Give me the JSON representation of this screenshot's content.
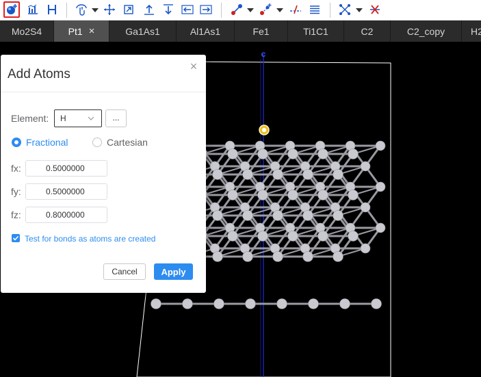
{
  "toolbar": {
    "buttons": [
      {
        "name": "add-atom-icon",
        "active": true
      },
      {
        "name": "bar-chart-icon"
      },
      {
        "name": "h-bonds-icon"
      },
      {
        "name": "rotate-hand-icon"
      },
      {
        "name": "move-icon"
      },
      {
        "name": "scale-icon"
      },
      {
        "name": "arrow-up-icon"
      },
      {
        "name": "arrow-down-icon"
      },
      {
        "name": "arrow-left-icon"
      },
      {
        "name": "arrow-right-icon"
      },
      {
        "name": "bond-icon"
      },
      {
        "name": "add-bond-icon"
      },
      {
        "name": "break-bond-icon"
      },
      {
        "name": "lines-icon"
      },
      {
        "name": "bond-length-icon"
      },
      {
        "name": "delete-bonds-icon"
      }
    ]
  },
  "tabs": [
    {
      "label": "Mo2S4",
      "active": false
    },
    {
      "label": "Pt1",
      "active": true,
      "close": "×"
    },
    {
      "label": "Ga1As1",
      "active": false
    },
    {
      "label": "Al1As1",
      "active": false
    },
    {
      "label": "Fe1",
      "active": false
    },
    {
      "label": "Ti1C1",
      "active": false
    },
    {
      "label": "C2",
      "active": false
    },
    {
      "label": "C2_copy",
      "active": false
    },
    {
      "label": "H2",
      "active": false
    }
  ],
  "viewport": {
    "axis_label": "c",
    "colors": {
      "atom": "#c9c9d0",
      "bond": "#9a9aa2",
      "axis": "#1f2fd0",
      "cell": "#ffffff",
      "selected": "#f0c020"
    }
  },
  "dialog": {
    "title": "Add Atoms",
    "close": "×",
    "element_label": "Element:",
    "element_value": "H",
    "browse_label": "...",
    "coord_modes": [
      {
        "label": "Fractional",
        "checked": true
      },
      {
        "label": "Cartesian",
        "checked": false
      }
    ],
    "fields": [
      {
        "label": "fx:",
        "value": "0.5000000"
      },
      {
        "label": "fy:",
        "value": "0.5000000"
      },
      {
        "label": "fz:",
        "value": "0.8000000"
      }
    ],
    "test_bonds_label": "Test for bonds as atoms are created",
    "test_bonds_checked": true,
    "cancel_label": "Cancel",
    "apply_label": "Apply"
  }
}
